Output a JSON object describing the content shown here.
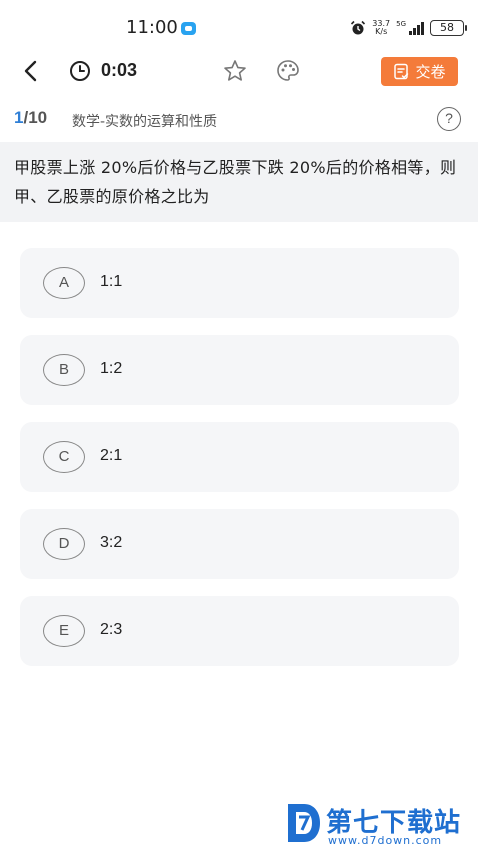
{
  "status_bar": {
    "time": "11:00",
    "net_speed_value": "33.7",
    "net_speed_unit": "K/s",
    "signal_label": "5G",
    "battery": "58"
  },
  "nav": {
    "timer": "0:03",
    "submit_label": "交卷",
    "accent_color": "#f47b3a"
  },
  "progress": {
    "current": "1",
    "total": "/10",
    "section": "数学-实数的运算和性质",
    "help_symbol": "?"
  },
  "question": {
    "text": "甲股票上涨 20%后价格与乙股票下跌 20%后的价格相等，则甲、乙股票的原价格之比为"
  },
  "options": [
    {
      "letter": "A",
      "text": "1:1"
    },
    {
      "letter": "B",
      "text": "1:2"
    },
    {
      "letter": "C",
      "text": "2:1"
    },
    {
      "letter": "D",
      "text": "3:2"
    },
    {
      "letter": "E",
      "text": "2:3"
    }
  ],
  "watermark": {
    "name": "第七下载站",
    "url": "www.d7down.com",
    "color": "#1f6fd0"
  }
}
